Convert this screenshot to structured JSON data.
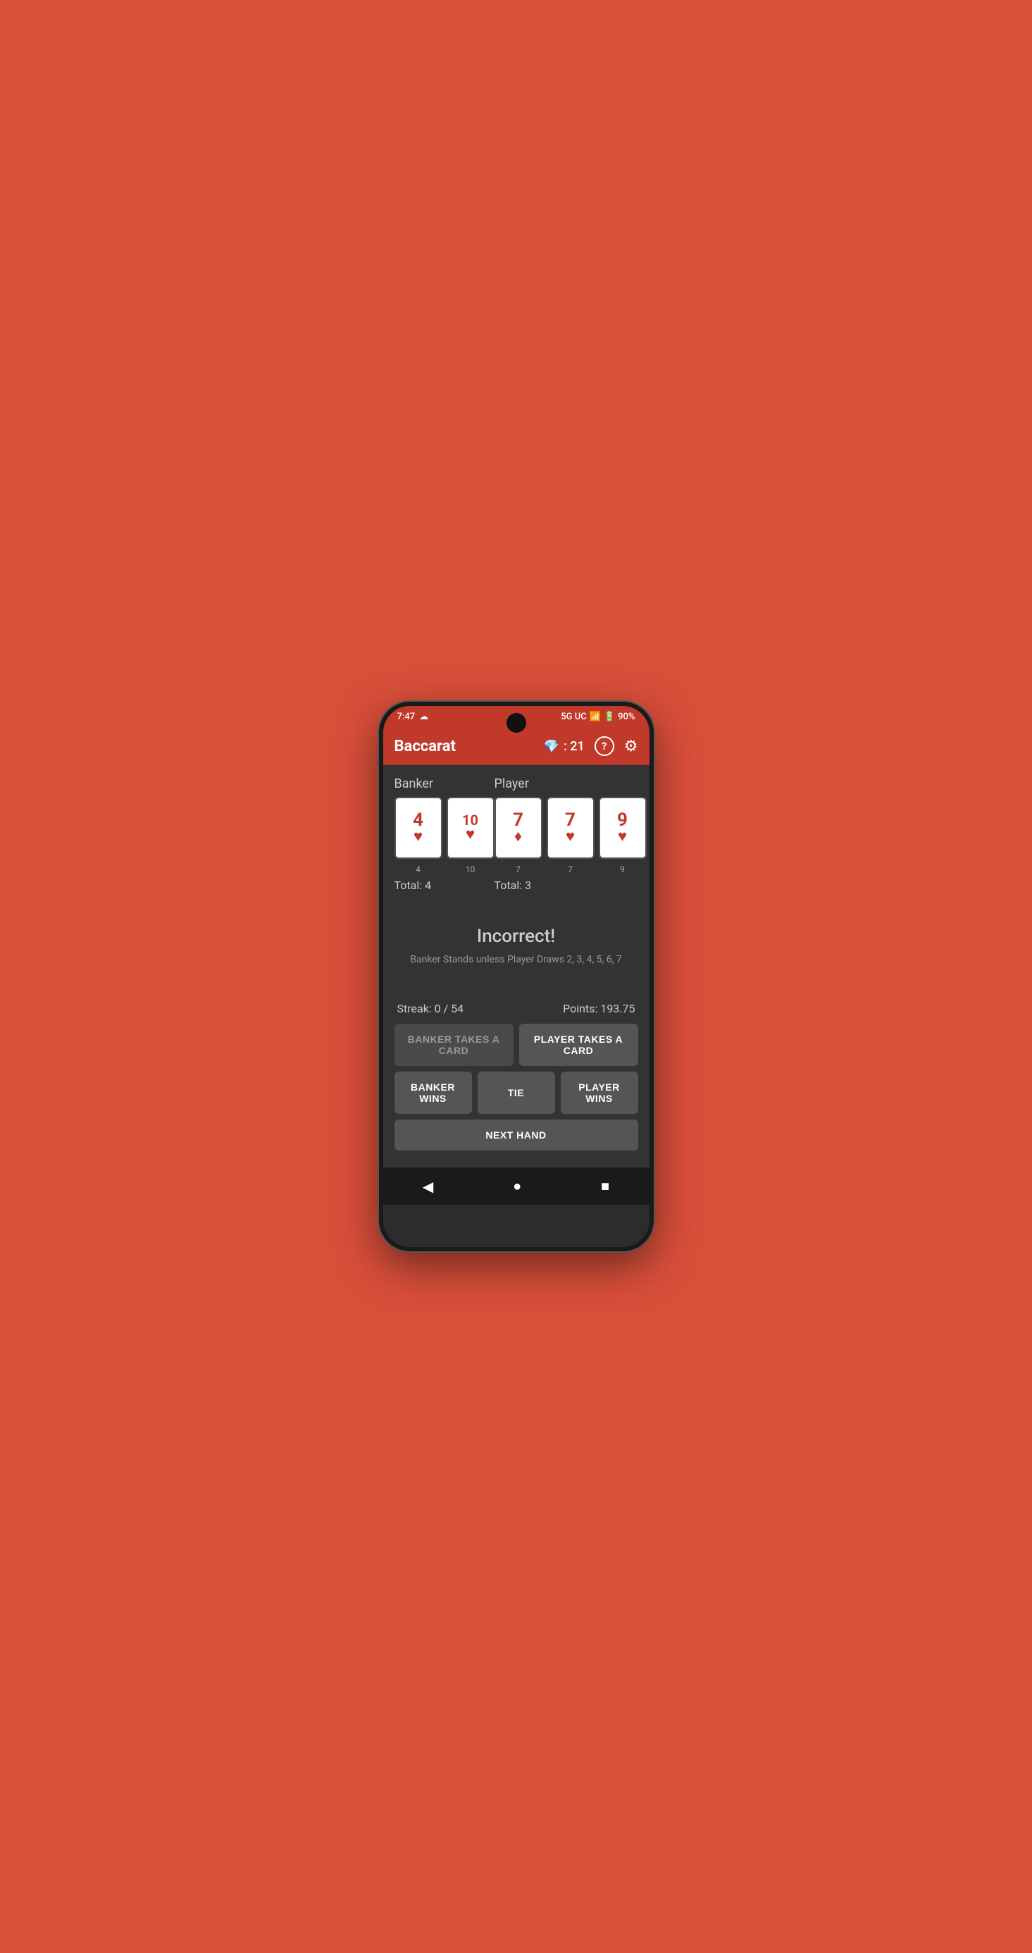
{
  "statusBar": {
    "time": "7:47",
    "network": "5G UC",
    "battery": "90%",
    "cloudIcon": "☁"
  },
  "appBar": {
    "title": "Baccarat",
    "gemIcon": "💎",
    "gemScore": "21",
    "helpIcon": "?",
    "settingsIcon": "⚙"
  },
  "banker": {
    "label": "Banker",
    "cards": [
      {
        "value": "4",
        "suit": "♥",
        "label": "4"
      },
      {
        "value": "10",
        "suit": "♥",
        "label": "10"
      }
    ],
    "total": "Total: 4"
  },
  "player": {
    "label": "Player",
    "cards": [
      {
        "value": "7",
        "suit": "♦",
        "label": "7"
      },
      {
        "value": "7",
        "suit": "♥",
        "label": "7"
      },
      {
        "value": "9",
        "suit": "♥",
        "label": "9"
      }
    ],
    "total": "Total: 3"
  },
  "result": {
    "title": "Incorrect!",
    "subtitle": "Banker Stands unless Player Draws 2, 3, 4, 5, 6, 7"
  },
  "stats": {
    "streak": "Streak: 0 / 54",
    "points": "Points: 193.75"
  },
  "buttons": {
    "bankerTakesCard": "BANKER TAKES A CARD",
    "playerTakesCard": "PLAYER TAKES A CARD",
    "bankerWins": "BANKER WINS",
    "tie": "TIE",
    "playerWins": "PLAYER WINS",
    "nextHand": "NEXT HAND"
  },
  "bottomNav": {
    "back": "◀",
    "home": "●",
    "recent": "■"
  }
}
